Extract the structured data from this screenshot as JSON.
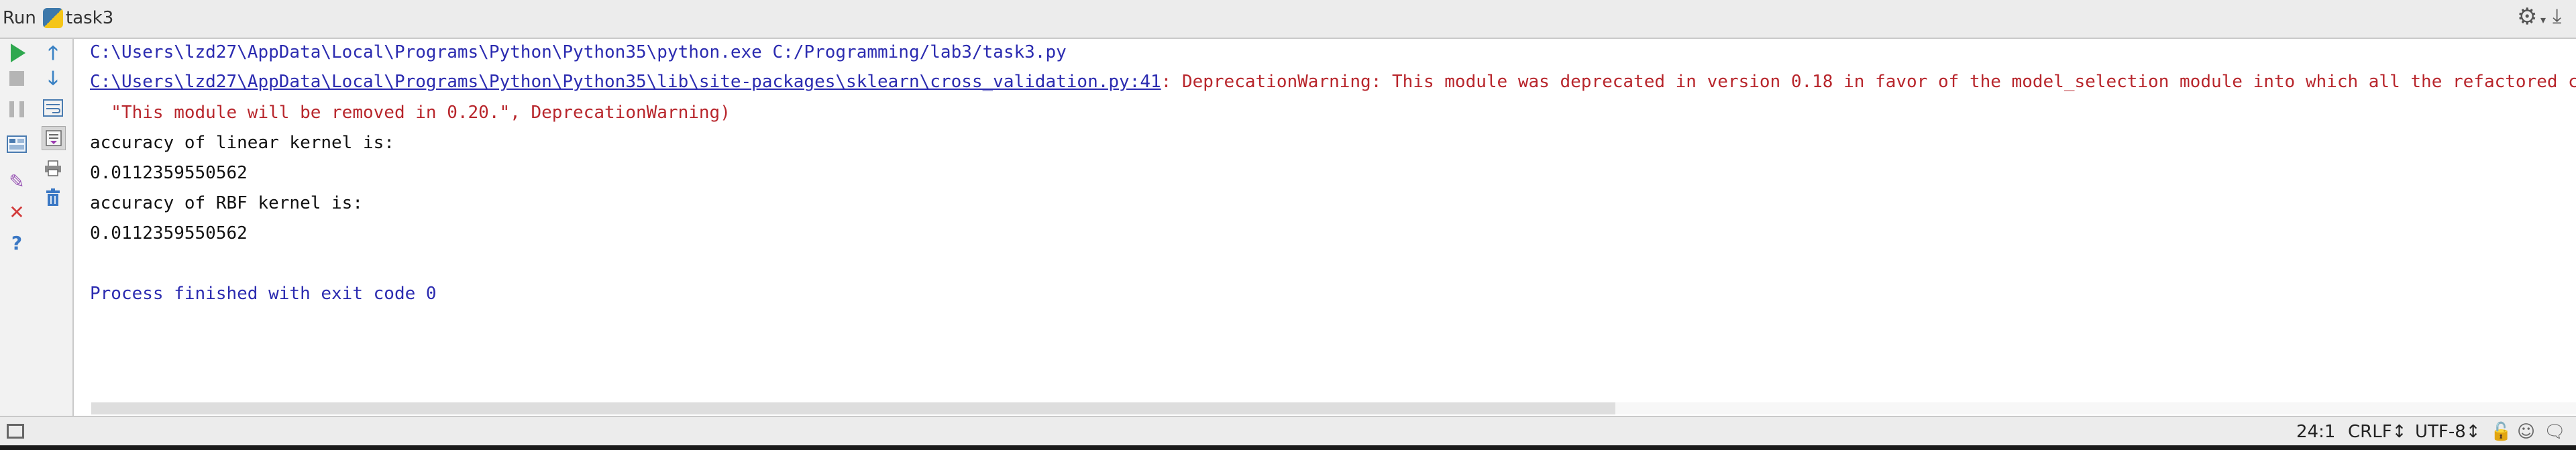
{
  "window": {
    "tool_window_title": "Run",
    "config_name": "task3"
  },
  "toolbar": {
    "left_column": [
      "run-icon",
      "stop-icon",
      "pause-icon",
      "layout-icon",
      "pin-icon",
      "close-icon",
      "help-icon"
    ],
    "right_column": [
      "up-arrow-icon",
      "down-arrow-icon",
      "soft-wrap-icon",
      "scroll-to-end-icon",
      "print-icon",
      "trash-icon"
    ]
  },
  "console": {
    "lines": [
      {
        "kind": "cmd",
        "text": "C:\\Users\\lzd27\\AppData\\Local\\Programs\\Python\\Python35\\python.exe C:/Programming/lab3/task3.py"
      },
      {
        "kind": "warning",
        "link": "C:\\Users\\lzd27\\AppData\\Local\\Programs\\Python\\Python35\\lib\\site-packages\\sklearn\\cross_validation.py:41",
        "text": ": DeprecationWarning: This module was deprecated in version 0.18 in favor of the model_selection module into which all the refactored classes and"
      },
      {
        "kind": "err",
        "text": "  \"This module will be removed in 0.20.\", DeprecationWarning)"
      },
      {
        "kind": "out",
        "text": "accuracy of linear kernel is:"
      },
      {
        "kind": "out",
        "text": "0.0112359550562"
      },
      {
        "kind": "out",
        "text": "accuracy of RBF kernel is:"
      },
      {
        "kind": "out",
        "text": "0.0112359550562"
      },
      {
        "kind": "out",
        "text": ""
      },
      {
        "kind": "cmd",
        "text": "Process finished with exit code 0"
      }
    ]
  },
  "statusbar": {
    "position": "24:1",
    "line_separator": "CRLF↕",
    "encoding": "UTF-8↕"
  },
  "colors": {
    "command": "#2b2bb0",
    "error": "#b8262c",
    "output": "#111111",
    "run_green": "#2fa84f"
  }
}
